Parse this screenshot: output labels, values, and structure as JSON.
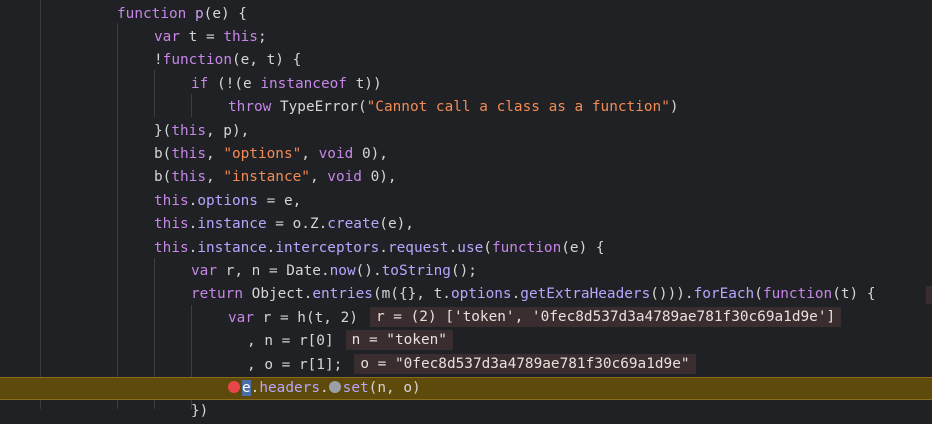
{
  "lines": [
    {
      "indent": 117,
      "tokens": [
        [
          "kw",
          "function "
        ],
        [
          "fn",
          "p"
        ],
        [
          "var",
          "(e) {"
        ]
      ]
    },
    {
      "indent": 154,
      "tokens": [
        [
          "kw",
          "var "
        ],
        [
          "var",
          "t = "
        ],
        [
          "kw",
          "this"
        ],
        [
          "var",
          ";"
        ]
      ]
    },
    {
      "indent": 154,
      "tokens": [
        [
          "var",
          "!"
        ],
        [
          "kw",
          "function"
        ],
        [
          "var",
          "(e, t) {"
        ]
      ]
    },
    {
      "indent": 191,
      "tokens": [
        [
          "kw",
          "if "
        ],
        [
          "var",
          "(!(e "
        ],
        [
          "kw",
          "instanceof "
        ],
        [
          "var",
          "t))"
        ]
      ]
    },
    {
      "indent": 228,
      "tokens": [
        [
          "kw",
          "throw "
        ],
        [
          "var",
          "TypeError("
        ],
        [
          "str",
          "\"Cannot call a class as a function\""
        ],
        [
          "var",
          ")"
        ]
      ]
    },
    {
      "indent": 154,
      "tokens": [
        [
          "var",
          "}("
        ],
        [
          "kw",
          "this"
        ],
        [
          "var",
          ", p),"
        ]
      ]
    },
    {
      "indent": 154,
      "tokens": [
        [
          "var",
          "b("
        ],
        [
          "kw",
          "this"
        ],
        [
          "var",
          ", "
        ],
        [
          "str",
          "\"options\""
        ],
        [
          "var",
          ", "
        ],
        [
          "kw",
          "void "
        ],
        [
          "var",
          "0),"
        ]
      ]
    },
    {
      "indent": 154,
      "tokens": [
        [
          "var",
          "b("
        ],
        [
          "kw",
          "this"
        ],
        [
          "var",
          ", "
        ],
        [
          "str",
          "\"instance\""
        ],
        [
          "var",
          ", "
        ],
        [
          "kw",
          "void "
        ],
        [
          "var",
          "0),"
        ]
      ]
    },
    {
      "indent": 154,
      "tokens": [
        [
          "kw",
          "this"
        ],
        [
          "var",
          "."
        ],
        [
          "prop",
          "options"
        ],
        [
          "var",
          " = e,"
        ]
      ]
    },
    {
      "indent": 154,
      "tokens": [
        [
          "kw",
          "this"
        ],
        [
          "var",
          "."
        ],
        [
          "prop",
          "instance"
        ],
        [
          "var",
          " = o.Z."
        ],
        [
          "prop",
          "create"
        ],
        [
          "var",
          "(e),"
        ]
      ]
    },
    {
      "indent": 154,
      "tokens": [
        [
          "kw",
          "this"
        ],
        [
          "var",
          "."
        ],
        [
          "prop",
          "instance"
        ],
        [
          "var",
          "."
        ],
        [
          "prop",
          "interceptors"
        ],
        [
          "var",
          "."
        ],
        [
          "prop",
          "request"
        ],
        [
          "var",
          "."
        ],
        [
          "prop",
          "use"
        ],
        [
          "var",
          "("
        ],
        [
          "kw",
          "function"
        ],
        [
          "var",
          "(e) {"
        ]
      ]
    },
    {
      "indent": 191,
      "tokens": [
        [
          "kw",
          "var "
        ],
        [
          "var",
          "r, n = Date."
        ],
        [
          "prop",
          "now"
        ],
        [
          "var",
          "()."
        ],
        [
          "prop",
          "toString"
        ],
        [
          "var",
          "();"
        ]
      ]
    },
    {
      "indent": 191,
      "tokens": [
        [
          "kw",
          "return "
        ],
        [
          "var",
          "Object."
        ],
        [
          "prop",
          "entries"
        ],
        [
          "var",
          "(m({}, t."
        ],
        [
          "prop",
          "options"
        ],
        [
          "var",
          "."
        ],
        [
          "prop",
          "getExtraHeaders"
        ],
        [
          "var",
          "()))."
        ],
        [
          "prop",
          "forEach"
        ],
        [
          "var",
          "("
        ],
        [
          "kw",
          "function"
        ],
        [
          "var",
          "(t) {"
        ]
      ],
      "trail": true
    },
    {
      "indent": 228,
      "tokens": [
        [
          "kw",
          "var "
        ],
        [
          "var",
          "r = h(t, 2)"
        ]
      ],
      "inline": "r = (2) ['token', '0fec8d537d3a4789ae781f30c69a1d9e']"
    },
    {
      "indent": 247,
      "tokens": [
        [
          "var",
          ", n = r[0]"
        ]
      ],
      "inline": "n = \"token\""
    },
    {
      "indent": 247,
      "tokens": [
        [
          "var",
          ", o = r[1];"
        ]
      ],
      "inline": "o = \"0fec8d537d3a4789ae781f30c69a1d9e\""
    },
    {
      "indent": 228,
      "paused": true,
      "tokens": [
        [
          "bpred",
          ""
        ],
        [
          "caret",
          "e"
        ],
        [
          "var",
          "."
        ],
        [
          "prop",
          "headers"
        ],
        [
          "var",
          "."
        ],
        [
          "bpgrey",
          ""
        ],
        [
          "prop",
          "set"
        ],
        [
          "var",
          "(n, o)"
        ]
      ]
    },
    {
      "indent": 191,
      "tokens": [
        [
          "var",
          "})"
        ]
      ]
    }
  ]
}
